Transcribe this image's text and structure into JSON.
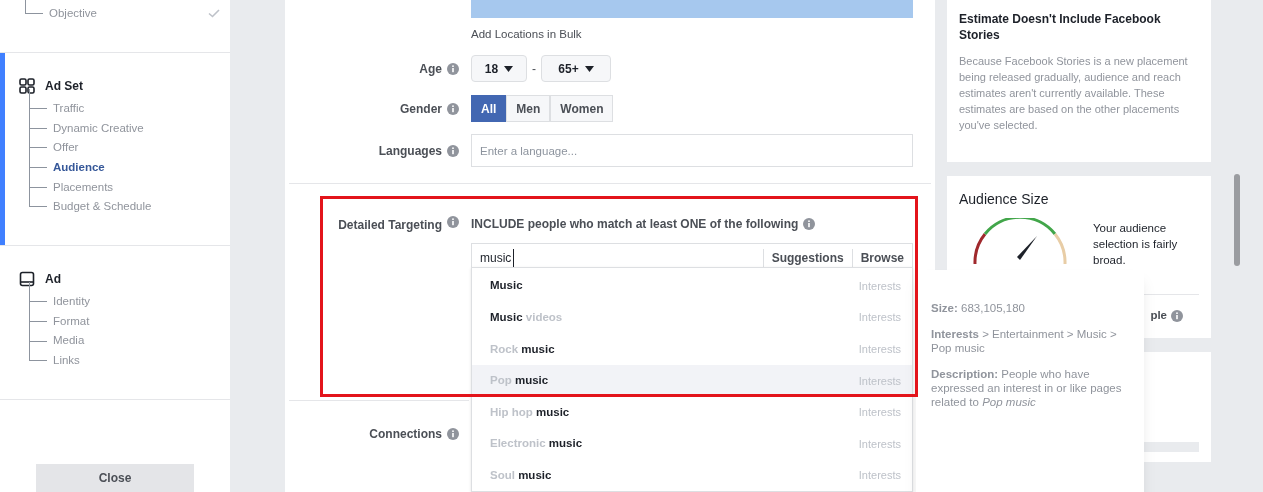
{
  "sidebar": {
    "sections": [
      {
        "items": [
          {
            "label": "Objective",
            "selected": false,
            "complete": true
          }
        ]
      },
      {
        "title": "Ad Set",
        "active": true,
        "items": [
          {
            "label": "Traffic",
            "selected": false,
            "complete": false
          },
          {
            "label": "Dynamic Creative",
            "selected": false,
            "complete": false
          },
          {
            "label": "Offer",
            "selected": false,
            "complete": false
          },
          {
            "label": "Audience",
            "selected": true,
            "complete": false
          },
          {
            "label": "Placements",
            "selected": false,
            "complete": false
          },
          {
            "label": "Budget & Schedule",
            "selected": false,
            "complete": false
          }
        ]
      },
      {
        "title": "Ad",
        "items": [
          {
            "label": "Identity",
            "selected": false,
            "complete": false
          },
          {
            "label": "Format",
            "selected": false,
            "complete": false
          },
          {
            "label": "Media",
            "selected": false,
            "complete": false
          },
          {
            "label": "Links",
            "selected": false,
            "complete": false
          }
        ]
      }
    ],
    "close_button": "Close"
  },
  "form": {
    "bulk_link": "Add Locations in Bulk",
    "age": {
      "label": "Age",
      "min": "18",
      "max": "65+",
      "separator": "-"
    },
    "gender": {
      "label": "Gender",
      "options": [
        {
          "label": "All",
          "selected": true
        },
        {
          "label": "Men",
          "selected": false
        },
        {
          "label": "Women",
          "selected": false
        }
      ]
    },
    "languages": {
      "label": "Languages",
      "placeholder": "Enter a language..."
    },
    "detailed_targeting": {
      "label": "Detailed Targeting",
      "include_text": "INCLUDE people who match at least ONE of the following",
      "search_value": "music",
      "suggestions_tab": "Suggestions",
      "browse_tab": "Browse",
      "results": [
        {
          "text": "**Music**",
          "category": "Interests",
          "selected": false
        },
        {
          "text": "**Music** videos",
          "category": "Interests",
          "selected": false
        },
        {
          "text": "Rock **music**",
          "category": "Interests",
          "selected": false
        },
        {
          "text": "Pop **music**",
          "category": "Interests",
          "selected": true
        },
        {
          "text": "Hip hop **music**",
          "category": "Interests",
          "selected": false
        },
        {
          "text": "Electronic **music**",
          "category": "Interests",
          "selected": false
        },
        {
          "text": "Soul **music**",
          "category": "Interests",
          "selected": false
        }
      ]
    },
    "connections": {
      "label": "Connections"
    }
  },
  "tooltip": {
    "size": "**Size:** 683,105,180",
    "path": "**Interests** > Entertainment > Music > Pop music",
    "description": "**Description:** People who have expressed an interest in or like pages related to *Pop music*"
  },
  "notice": {
    "title": "Estimate Doesn't Include Facebook Stories",
    "body": "Because Facebook Stories is a new placement being released gradually, audience and reach estimates aren't currently available. These estimates are based on the other placements you've selected."
  },
  "audience_size": {
    "title": "Audience Size",
    "verdict": "Your audience selection is fairly broad.",
    "reach_fragment": "ple"
  }
}
